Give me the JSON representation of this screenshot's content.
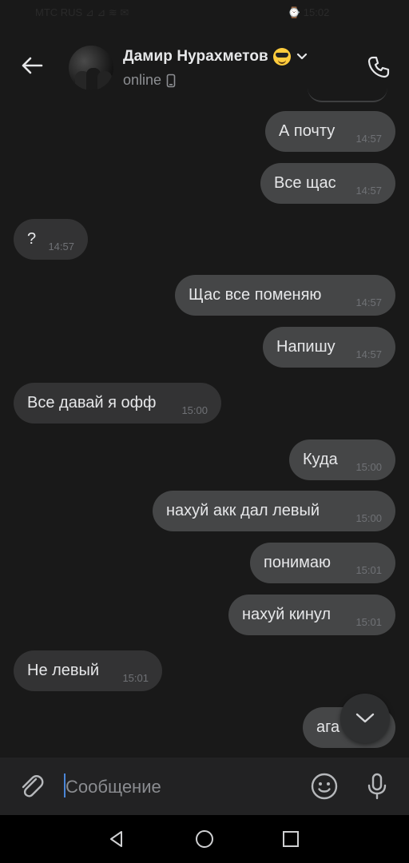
{
  "statusbar": {
    "left_text": "МТС RUS  ⊿  ⊿  ≋  ✉",
    "right_text": "⌚ 15:02"
  },
  "header": {
    "back_icon": "arrow-left-icon",
    "contact_name": "Дамир Нурахметов",
    "name_emoji": "smiling-face-with-sunglasses-icon",
    "status": "online",
    "status_device_icon": "mobile-phone-icon",
    "call_icon": "phone-icon"
  },
  "messages": [
    {
      "text": "А почту",
      "time": "14:57",
      "outgoing": true
    },
    {
      "text": "Все щас",
      "time": "14:57",
      "outgoing": true
    },
    {
      "text": "?",
      "time": "14:57",
      "outgoing": false
    },
    {
      "text": "Щас все поменяю",
      "time": "14:57",
      "outgoing": true
    },
    {
      "text": "Напишу",
      "time": "14:57",
      "outgoing": true
    },
    {
      "text": "Все давай я офф",
      "time": "15:00",
      "outgoing": false
    },
    {
      "text": "Куда",
      "time": "15:00",
      "outgoing": true
    },
    {
      "text": "нахуй акк дал левый",
      "time": "15:00",
      "outgoing": true
    },
    {
      "text": "понимаю",
      "time": "15:01",
      "outgoing": true
    },
    {
      "text": "нахуй кинул",
      "time": "15:01",
      "outgoing": true
    },
    {
      "text": "Не левый",
      "time": "15:01",
      "outgoing": false
    },
    {
      "text": "ага",
      "time": "",
      "outgoing": true
    }
  ],
  "composer": {
    "placeholder": "Сообщение",
    "attach_icon": "paperclip-icon",
    "emoji_icon": "smiley-icon",
    "mic_icon": "microphone-icon"
  },
  "scroll_down_icon": "chevron-down-icon",
  "navbar": {
    "back": "triangle-back-icon",
    "home": "circle-home-icon",
    "recents": "square-recents-icon"
  },
  "colors": {
    "background": "#191919",
    "bubble_in": "#333334",
    "bubble_out": "#454647",
    "accent_cursor": "#4a86d8"
  }
}
